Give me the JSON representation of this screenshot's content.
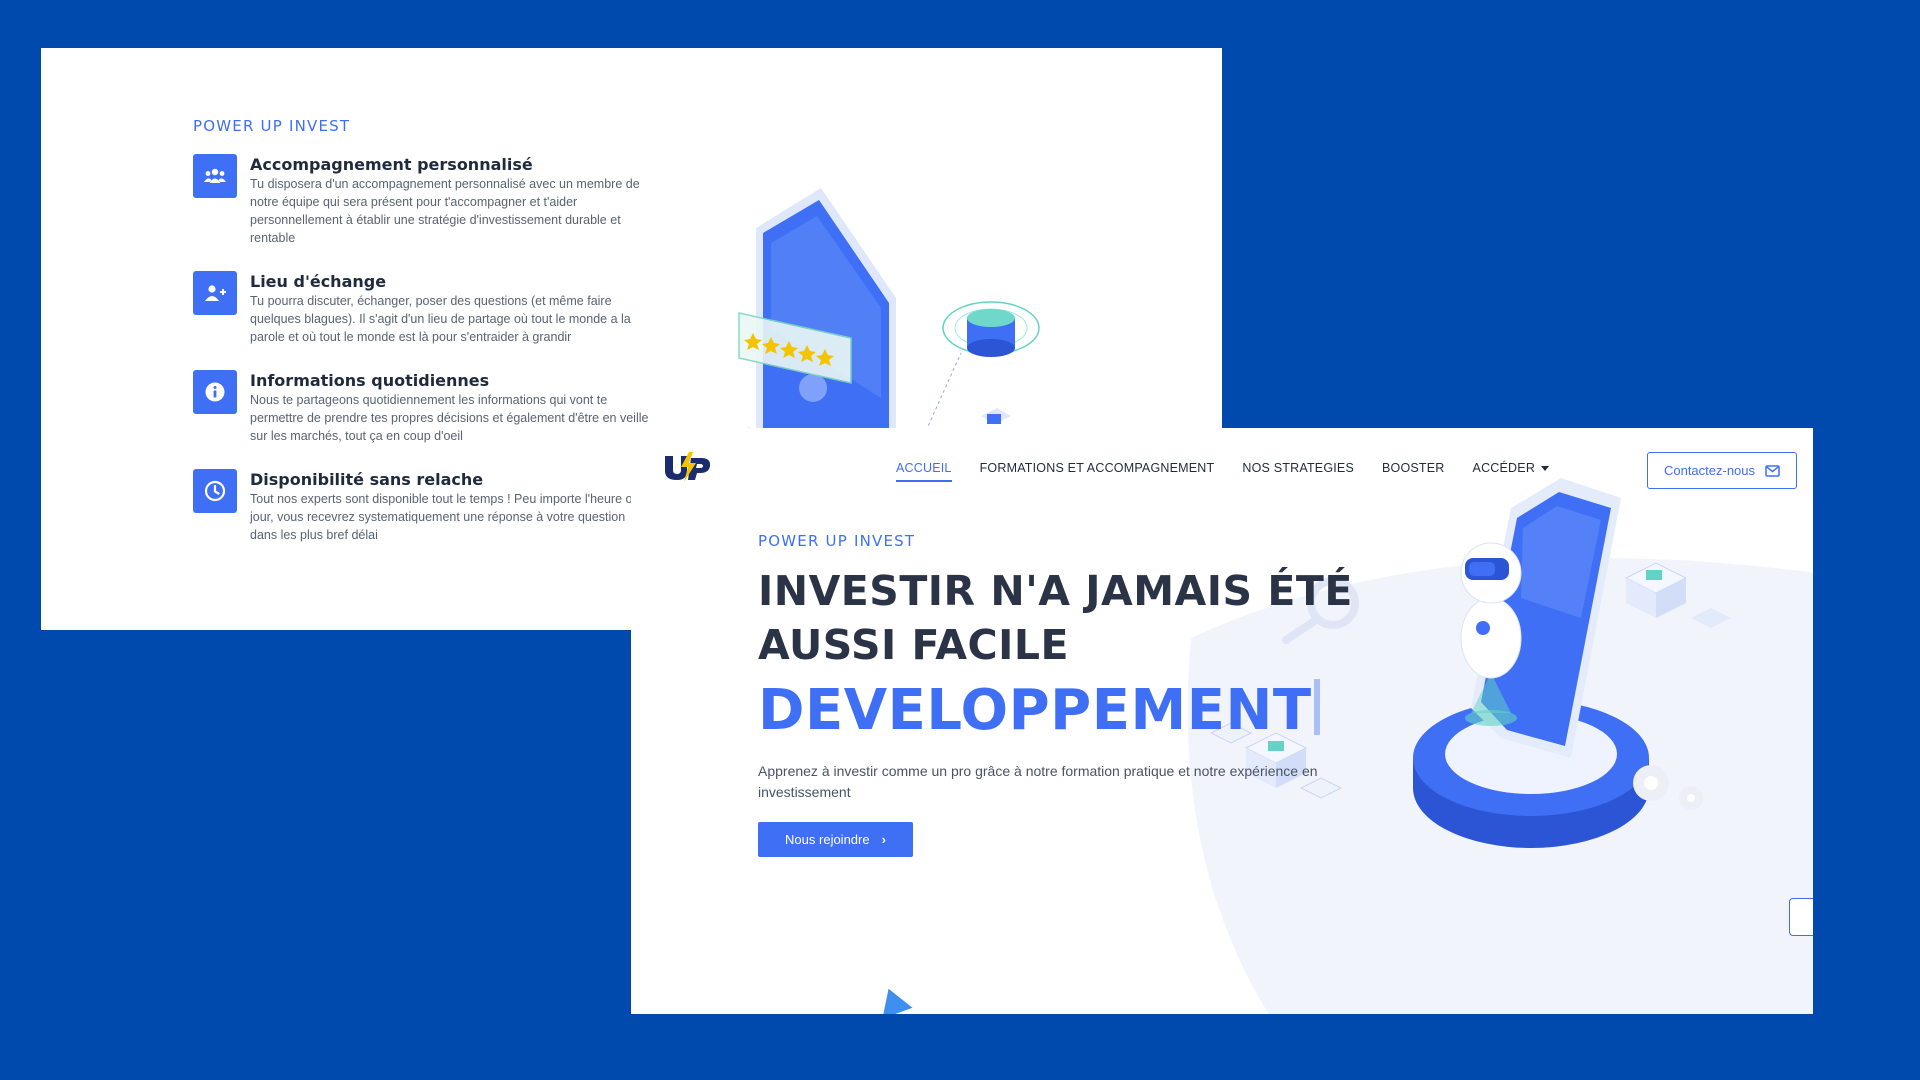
{
  "features_section": {
    "eyebrow": "POWER UP INVEST",
    "items": [
      {
        "icon": "users-group-icon",
        "title": "Accompagnement personnalisé",
        "text": "Tu disposera d'un accompagnement personnalisé avec un membre de notre équipe qui sera présent pour t'accompagner et t'aider personnellement à établir une stratégie d'investissement durable et rentable"
      },
      {
        "icon": "user-plus-icon",
        "title": "Lieu d'échange",
        "text": "Tu pourra discuter, échanger, poser des questions (et même faire quelques blagues). Il s'agit d'un lieu de partage où tout le monde a la parole et où tout le monde est là pour s'entraider à grandir"
      },
      {
        "icon": "info-circle-icon",
        "title": "Informations quotidiennes",
        "text": "Nous te partageons quotidiennement les informations qui vont te permettre de prendre tes propres décisions et également d'être en veille sur les marchés, tout ça en coup d'oeil"
      },
      {
        "icon": "clock-icon",
        "title": "Disponibilité sans relache",
        "text": "Tout nos experts sont disponible tout le temps ! Peu importe l'heure ou le jour, vous recevrez systematiquement une réponse à votre question dans les plus bref délai"
      }
    ]
  },
  "nav": {
    "logo_text": "UP",
    "links": [
      "ACCUEIL",
      "FORMATIONS ET ACCOMPAGNEMENT",
      "NOS STRATEGIES",
      "BOOSTER",
      "ACCÉDER"
    ],
    "active_link": "ACCUEIL",
    "contact_label": "Contactez-nous"
  },
  "hero": {
    "eyebrow": "POWER UP INVEST",
    "title_line1": "INVESTIR N'A JAMAIS ÉTÉ",
    "title_line2": "AUSSI FACILE",
    "typed_word": "DEVELOPPEMENT",
    "subtitle": "Apprenez à investir comme un pro grâce à notre formation pratique et notre expérience en investissement",
    "cta_label": "Nous rejoindre"
  },
  "colors": {
    "background": "#004aad",
    "accent": "#3f6ff5",
    "heading": "#2b3446",
    "star": "#f5c400"
  }
}
